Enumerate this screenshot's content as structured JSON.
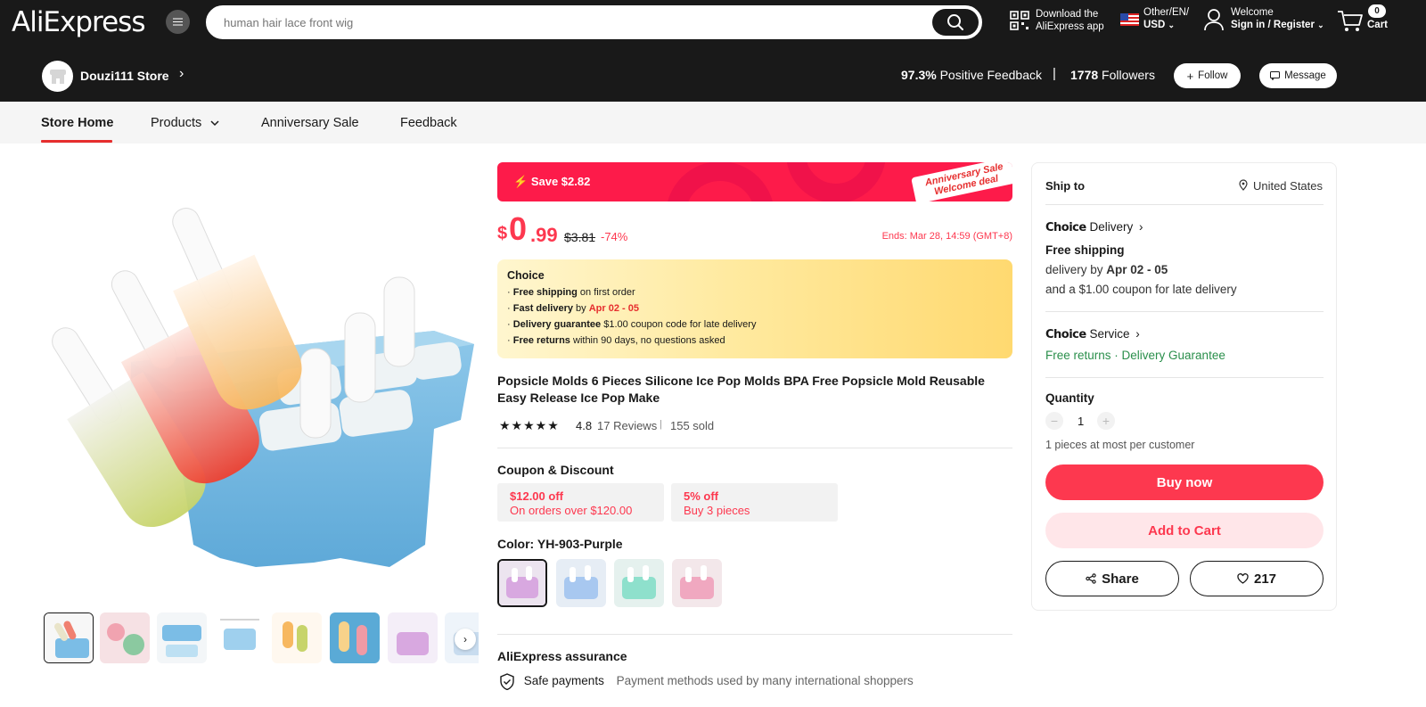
{
  "header": {
    "logo": "AliExpress",
    "search_placeholder": "human hair lace front wig",
    "download_line1": "Download the",
    "download_line2": "AliExpress app",
    "locale_line1": "Other/EN/",
    "locale_line2": "USD",
    "welcome_line1": "Welcome",
    "welcome_line2": "Sign in / Register",
    "cart_count": "0",
    "cart_label": "Cart"
  },
  "store": {
    "name": "Douzi111 Store",
    "feedback_value": "97.3%",
    "feedback_label": "Positive Feedback",
    "separator": "|",
    "followers_value": "1778",
    "followers_label": "Followers",
    "follow_label": "Follow",
    "message_label": "Message"
  },
  "nav": {
    "items": [
      "Store Home",
      "Products",
      "Anniversary Sale",
      "Feedback"
    ]
  },
  "promo": {
    "save": "Save $2.82",
    "tag_line1": "Anniversary Sale",
    "tag_line2": "Welcome deal"
  },
  "price": {
    "currency": "$",
    "int": "0",
    "dec": ".99",
    "original": "$3.81",
    "discount": "-74%",
    "ends": "Ends: Mar 28, 14:59 (GMT+8)"
  },
  "choice": {
    "title": "Choice",
    "lines": [
      {
        "bold": "Free shipping",
        "rest": " on first order",
        "red": ""
      },
      {
        "bold": "Fast delivery",
        "rest": " by ",
        "red": "Apr 02 - 05"
      },
      {
        "bold": "Delivery guarantee",
        "rest": "  $1.00 coupon code for late delivery",
        "red": ""
      },
      {
        "bold": "Free returns",
        "rest": "  within 90 days, no questions asked",
        "red": ""
      }
    ],
    "bullet": "·"
  },
  "product": {
    "title": "Popsicle Molds 6 Pieces Silicone Ice Pop Molds BPA Free Popsicle Mold Reusable Easy Release Ice Pop Make",
    "stars": "★★★★★",
    "rating": "4.8",
    "reviews": "17 Reviews",
    "sold_sep": "|",
    "sold": "155 sold"
  },
  "coupons": {
    "title": "Coupon & Discount",
    "items": [
      {
        "headline": "$12.00 off",
        "detail": "On orders over $120.00"
      },
      {
        "headline": "5% off",
        "detail": "Buy 3 pieces"
      }
    ]
  },
  "color": {
    "label": "Color: YH-903-Purple",
    "swatches": [
      "purple",
      "blue",
      "green",
      "pink"
    ],
    "swatch_colors": [
      "#d8a8e0",
      "#a8c8f0",
      "#8ee0cc",
      "#f0a8c0"
    ]
  },
  "assurance": {
    "title": "AliExpress assurance",
    "item_title": "Safe payments",
    "item_desc": "Payment methods used by many international shoppers"
  },
  "panel": {
    "ship_to_label": "Ship to",
    "ship_to_value": "United States",
    "choice_word": "Choice",
    "delivery_word": "Delivery",
    "free_shipping": "Free shipping",
    "delivery_by": "delivery by ",
    "delivery_date": "Apr 02 - 05",
    "coupon_late": "and a $1.00 coupon for late delivery",
    "service_word": "Service",
    "free_returns": "Free returns",
    "dot": " · ",
    "delivery_guarantee": "Delivery Guarantee",
    "quantity_label": "Quantity",
    "minus": "−",
    "qty": "1",
    "plus": "+",
    "qty_limit": "1 pieces at most per customer",
    "buy_now": "Buy now",
    "add_to_cart": "Add to Cart",
    "share": "Share",
    "wishlist_count": "217"
  },
  "colors": {
    "brand_red": "#fd384f",
    "header_bg": "#191919",
    "green": "#00a550"
  }
}
